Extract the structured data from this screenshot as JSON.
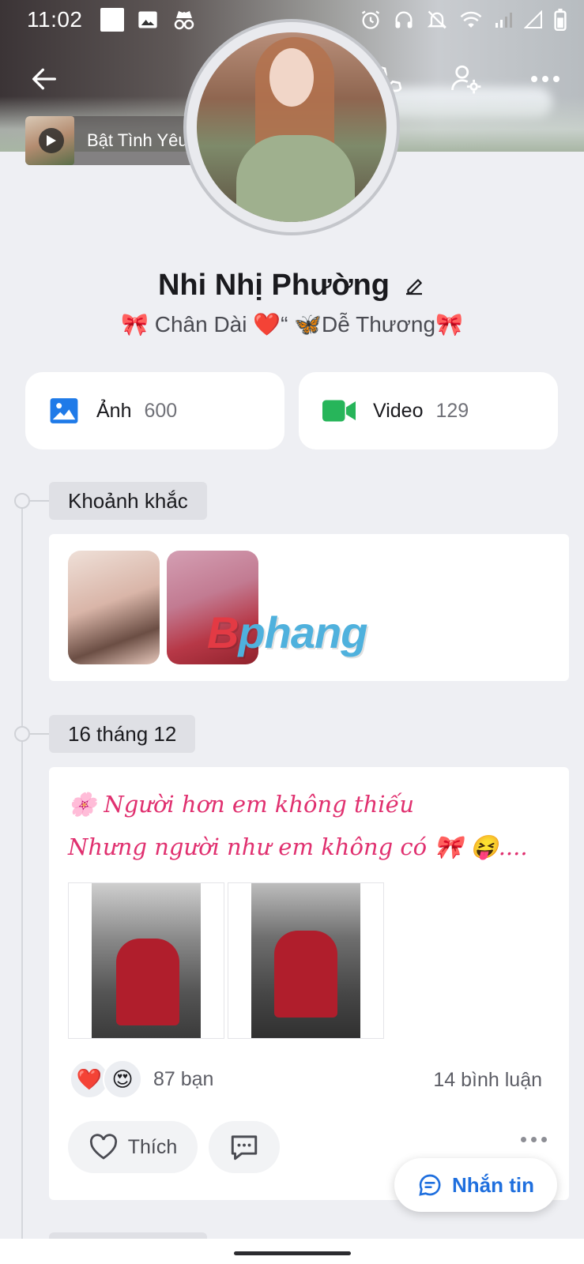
{
  "status_bar": {
    "time": "11:02"
  },
  "music": {
    "title": "Bật Tình Yêu L"
  },
  "profile": {
    "name": "Nhi Nhị Phường",
    "bio": "🎀  Chân Dài ❤️“ 🦋Dễ Thương🎀"
  },
  "media": {
    "photos": {
      "label": "Ảnh",
      "count": "600"
    },
    "videos": {
      "label": "Video",
      "count": "129"
    }
  },
  "timeline": {
    "moments_label": "Khoảnh khắc",
    "watermark": {
      "first": "B",
      "rest": "phang"
    },
    "date_label": "16 tháng 12"
  },
  "post": {
    "text_line1": "🌸 Người hơn em không thiếu",
    "text_line2": "Nhưng người như em không có￼ 🎀 😝....",
    "reaction_icons": [
      "❤️",
      "😍"
    ],
    "reaction_count": "87 bạn",
    "comment_count": "14 bình luận",
    "like_label": "Thích"
  },
  "fab": {
    "label": "Nhắn tin"
  },
  "colors": {
    "accent": "#1f6fde",
    "post_text": "#e0306f",
    "video_icon": "#27b55a",
    "photo_icon": "#1f7ae8"
  }
}
